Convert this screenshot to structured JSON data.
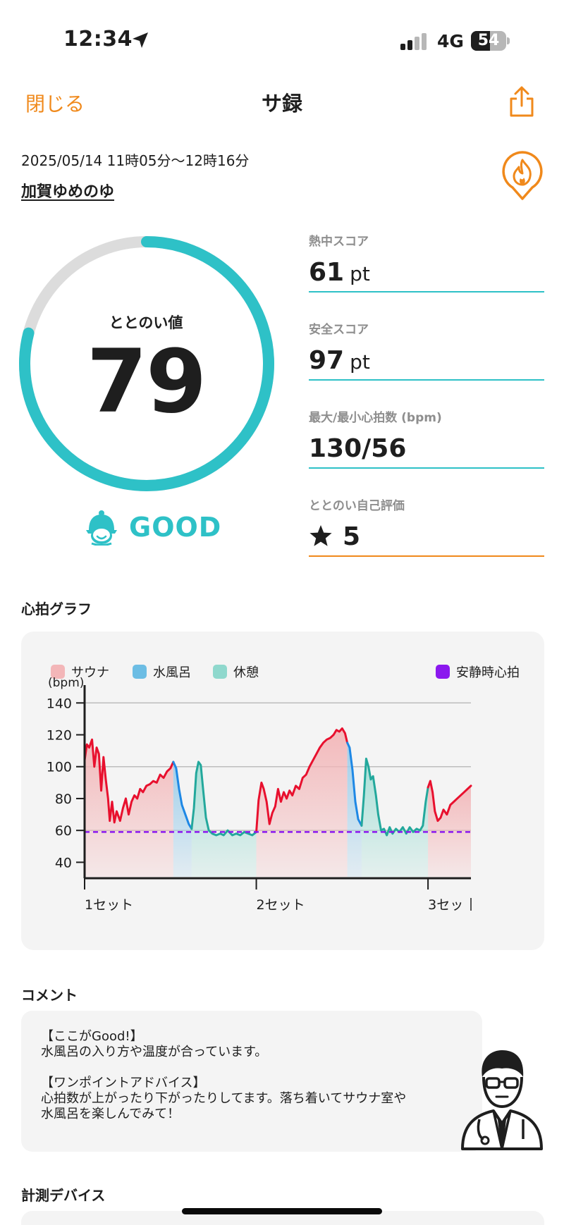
{
  "status_bar": {
    "time": "12:34",
    "network": "4G",
    "battery": "54",
    "battery_level": 0.54
  },
  "nav": {
    "close_label": "閉じる",
    "title": "サ録"
  },
  "session": {
    "date_range": "2025/05/14 11時05分〜12時16分",
    "facility": "加賀ゆめのゆ"
  },
  "totonoi": {
    "label": "ととのい値",
    "value": "79",
    "max": 100,
    "rating": "GOOD"
  },
  "metrics": [
    {
      "label": "熱中スコア",
      "value": "61",
      "unit": "pt"
    },
    {
      "label": "安全スコア",
      "value": "97",
      "unit": "pt"
    },
    {
      "label": "最大/最小心拍数 (bpm)",
      "value": "130/56",
      "unit": ""
    },
    {
      "label": "ととのい自己評価",
      "value": "5",
      "unit": ""
    }
  ],
  "heart_section": {
    "title": "心拍グラフ"
  },
  "chart_data": {
    "type": "line",
    "ylabel": "(bpm)",
    "y_ticks": [
      "140",
      "120",
      "100",
      "80",
      "60",
      "40"
    ],
    "ylim": [
      30,
      145
    ],
    "x_ticks": [
      "1セット",
      "2セット",
      "3セッ"
    ],
    "legend": [
      {
        "name": "サウナ",
        "color": "#f3b6b8"
      },
      {
        "name": "水風呂",
        "color": "#6cbde4"
      },
      {
        "name": "休憩",
        "color": "#8fd8cd"
      },
      {
        "name": "安静時心拍",
        "color": "#8b18ee"
      }
    ],
    "resting_hr": 59,
    "grid": true,
    "phases": [
      {
        "type": "sauna",
        "x0": 0,
        "x1": 15.5,
        "color": "#e8102e"
      },
      {
        "type": "cold",
        "x0": 15.5,
        "x1": 18.7,
        "color": "#1e88e5"
      },
      {
        "type": "rest",
        "x0": 18.7,
        "x1": 30,
        "color": "#23a89c"
      },
      {
        "type": "sauna",
        "x0": 30,
        "x1": 45.9,
        "color": "#e8102e"
      },
      {
        "type": "cold",
        "x0": 45.9,
        "x1": 48.4,
        "color": "#1e88e5"
      },
      {
        "type": "rest",
        "x0": 48.4,
        "x1": 60,
        "color": "#23a89c"
      },
      {
        "type": "sauna",
        "x0": 60,
        "x1": 67.5,
        "color": "#e8102e"
      }
    ],
    "series": [
      {
        "values": [
          [
            0,
            104
          ],
          [
            0.4,
            114
          ],
          [
            0.8,
            112
          ],
          [
            1.3,
            117
          ],
          [
            1.7,
            100
          ],
          [
            2.1,
            112
          ],
          [
            2.5,
            108
          ],
          [
            2.9,
            85
          ],
          [
            3.3,
            106
          ],
          [
            3.7,
            92
          ],
          [
            4.1,
            80
          ],
          [
            4.4,
            66
          ],
          [
            4.8,
            78
          ],
          [
            5.2,
            65
          ],
          [
            5.6,
            72
          ],
          [
            6.2,
            66
          ],
          [
            6.7,
            74
          ],
          [
            7.2,
            80
          ],
          [
            7.7,
            70
          ],
          [
            8.2,
            78
          ],
          [
            8.7,
            82
          ],
          [
            9.2,
            80
          ],
          [
            9.7,
            86
          ],
          [
            10.2,
            84
          ],
          [
            10.8,
            88
          ],
          [
            11.4,
            89
          ],
          [
            12,
            91
          ],
          [
            12.6,
            90
          ],
          [
            13.2,
            95
          ],
          [
            13.8,
            93
          ],
          [
            14.4,
            97
          ],
          [
            15,
            99
          ],
          [
            15.5,
            103
          ]
        ]
      },
      {
        "values": [
          [
            15.5,
            103
          ],
          [
            16,
            99
          ],
          [
            16.5,
            86
          ],
          [
            17,
            76
          ],
          [
            17.6,
            70
          ],
          [
            18.2,
            64
          ],
          [
            18.7,
            61
          ]
        ]
      },
      {
        "values": [
          [
            18.7,
            61
          ],
          [
            19.1,
            74
          ],
          [
            19.5,
            96
          ],
          [
            19.9,
            103
          ],
          [
            20.3,
            101
          ],
          [
            20.7,
            86
          ],
          [
            21.2,
            68
          ],
          [
            21.7,
            60
          ],
          [
            22.3,
            58
          ],
          [
            23,
            57
          ],
          [
            23.7,
            58
          ],
          [
            24.3,
            57
          ],
          [
            25,
            60
          ],
          [
            25.8,
            57
          ],
          [
            26.5,
            58
          ],
          [
            27.2,
            57
          ],
          [
            27.9,
            59
          ],
          [
            28.6,
            58
          ],
          [
            29.3,
            57
          ],
          [
            30,
            59
          ]
        ]
      },
      {
        "values": [
          [
            30,
            59
          ],
          [
            30.4,
            79
          ],
          [
            30.9,
            90
          ],
          [
            31.3,
            86
          ],
          [
            31.8,
            78
          ],
          [
            32.3,
            64
          ],
          [
            32.8,
            71
          ],
          [
            33.3,
            75
          ],
          [
            33.8,
            86
          ],
          [
            34.3,
            78
          ],
          [
            34.8,
            84
          ],
          [
            35.3,
            80
          ],
          [
            35.8,
            85
          ],
          [
            36.3,
            82
          ],
          [
            36.9,
            88
          ],
          [
            37.5,
            86
          ],
          [
            38.1,
            93
          ],
          [
            38.7,
            95
          ],
          [
            39.3,
            100
          ],
          [
            39.9,
            104
          ],
          [
            40.5,
            108
          ],
          [
            41.1,
            112
          ],
          [
            41.7,
            115
          ],
          [
            42.3,
            117
          ],
          [
            42.9,
            118
          ],
          [
            43.5,
            120
          ],
          [
            44,
            123
          ],
          [
            44.5,
            122
          ],
          [
            45,
            124
          ],
          [
            45.5,
            121
          ],
          [
            45.9,
            115
          ]
        ]
      },
      {
        "values": [
          [
            45.9,
            115
          ],
          [
            46.3,
            112
          ],
          [
            46.8,
            98
          ],
          [
            47.3,
            78
          ],
          [
            47.8,
            67
          ],
          [
            48.4,
            63
          ]
        ]
      },
      {
        "values": [
          [
            48.4,
            63
          ],
          [
            48.8,
            82
          ],
          [
            49.2,
            105
          ],
          [
            49.6,
            100
          ],
          [
            50,
            92
          ],
          [
            50.4,
            94
          ],
          [
            50.9,
            82
          ],
          [
            51.3,
            70
          ],
          [
            51.8,
            60
          ],
          [
            52.3,
            61
          ],
          [
            52.8,
            57
          ],
          [
            53.3,
            62
          ],
          [
            53.8,
            58
          ],
          [
            54.4,
            61
          ],
          [
            55,
            59
          ],
          [
            55.6,
            62
          ],
          [
            56.2,
            58
          ],
          [
            56.8,
            62
          ],
          [
            57.4,
            59
          ],
          [
            58,
            61
          ],
          [
            58.6,
            60
          ],
          [
            59.1,
            63
          ],
          [
            59.6,
            78
          ],
          [
            60,
            87
          ]
        ]
      },
      {
        "values": [
          [
            60,
            87
          ],
          [
            60.4,
            91
          ],
          [
            60.8,
            84
          ],
          [
            61.2,
            72
          ],
          [
            61.7,
            66
          ],
          [
            62.2,
            68
          ],
          [
            62.7,
            73
          ],
          [
            63.3,
            70
          ],
          [
            63.9,
            76
          ],
          [
            64.5,
            78
          ],
          [
            65.1,
            80
          ],
          [
            65.7,
            82
          ],
          [
            66.3,
            84
          ],
          [
            66.9,
            86
          ],
          [
            67.5,
            88
          ]
        ]
      }
    ]
  },
  "comment_section": {
    "title": "コメント",
    "good_heading": "【ここがGood!】",
    "good_text": "水風呂の入り方や温度が合っています。",
    "advice_heading": "【ワンポイントアドバイス】",
    "advice_line1": "心拍数が上がったり下がったりしてます。落ち着いてサウナ室や",
    "advice_line2": "水風呂を楽しんでみて！"
  },
  "device_section": {
    "title": "計測デバイス"
  },
  "colors": {
    "accent_orange": "#f0891b",
    "accent_teal": "#2ec1c7"
  }
}
